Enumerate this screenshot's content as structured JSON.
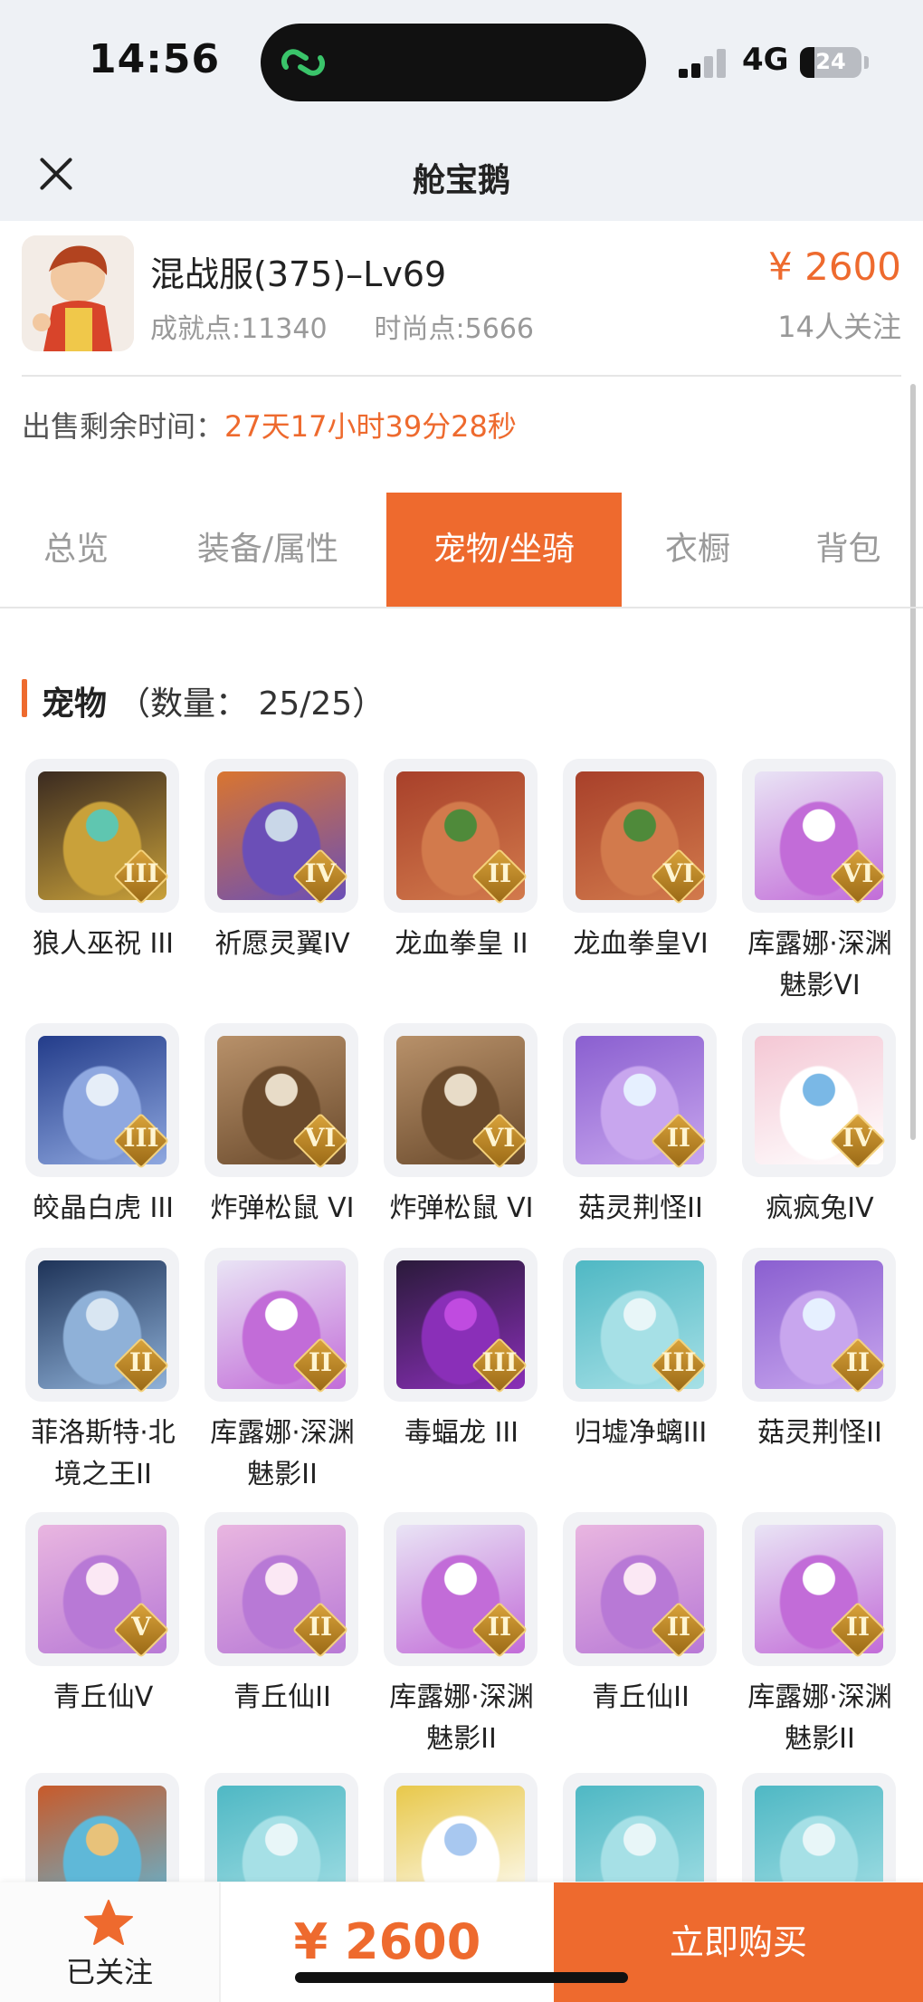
{
  "status_bar": {
    "time": "14:56",
    "network": "4G",
    "battery": "24",
    "battery_level": 0.24
  },
  "nav": {
    "title": "舱宝鹅"
  },
  "product": {
    "name": "混战服(375)–Lv69",
    "achievement": "成就点:11340",
    "fashion": "时尚点:5666",
    "price": "¥ 2600",
    "followers": "14人关注"
  },
  "sale": {
    "label": "出售剩余时间：",
    "value": "27天17小时39分28秒"
  },
  "tabs": [
    {
      "label": "总览",
      "active": false
    },
    {
      "label": "装备/属性",
      "active": false
    },
    {
      "label": "宠物/坐骑",
      "active": true
    },
    {
      "label": "衣橱",
      "active": false
    },
    {
      "label": "背包",
      "active": false
    }
  ],
  "section": {
    "title": "宠物",
    "count": "（数量：  25/25）"
  },
  "pets": [
    {
      "name": "狼人巫祝 III",
      "rank": "III",
      "icon": "werewolf-shaman-icon",
      "colors": [
        "#3a2a20",
        "#c9a13a",
        "#5fc6b0"
      ]
    },
    {
      "name": "祈愿灵翼IV",
      "rank": "IV",
      "icon": "wish-wing-eagle-icon",
      "colors": [
        "#d9752f",
        "#6b4fb7",
        "#c9d7e8"
      ]
    },
    {
      "name": "龙血拳皇 II",
      "rank": "II",
      "icon": "dragonblood-boxer-icon",
      "colors": [
        "#a8402a",
        "#d27a4c",
        "#4f8a3a"
      ]
    },
    {
      "name": "龙血拳皇VI",
      "rank": "VI",
      "icon": "dragonblood-boxer-icon",
      "colors": [
        "#a8402a",
        "#d27a4c",
        "#4f8a3a"
      ]
    },
    {
      "name": "库露娜·深渊魅影VI",
      "rank": "VI",
      "icon": "kuluna-abyss-icon",
      "colors": [
        "#e9e4f5",
        "#c26cd8",
        "#ffffff"
      ]
    },
    {
      "name": "皎晶白虎 III",
      "rank": "III",
      "icon": "crystal-white-tiger-icon",
      "colors": [
        "#233c8a",
        "#8fa8e0",
        "#e6eef8"
      ]
    },
    {
      "name": "炸弹松鼠 VI",
      "rank": "VI",
      "icon": "bomb-squirrel-icon",
      "colors": [
        "#b8916a",
        "#6a4a2c",
        "#e8dcc8"
      ]
    },
    {
      "name": "炸弹松鼠 VI",
      "rank": "VI",
      "icon": "bomb-squirrel-icon",
      "colors": [
        "#b8916a",
        "#6a4a2c",
        "#e8dcc8"
      ]
    },
    {
      "name": "菇灵荆怪II",
      "rank": "II",
      "icon": "mushroom-spirit-icon",
      "colors": [
        "#8a5fd0",
        "#c8a6ee",
        "#e6f0ff"
      ]
    },
    {
      "name": "疯疯兔IV",
      "rank": "IV",
      "icon": "crazy-rabbit-icon",
      "colors": [
        "#f4c7d4",
        "#ffffff",
        "#7ab8e6"
      ]
    },
    {
      "name": "菲洛斯特·北境之王II",
      "rank": "II",
      "icon": "frost-king-icon",
      "colors": [
        "#1e3358",
        "#8fb1d8",
        "#d9e6f2"
      ]
    },
    {
      "name": "库露娜·深渊魅影II",
      "rank": "II",
      "icon": "kuluna-abyss-icon",
      "colors": [
        "#e9e4f5",
        "#c26cd8",
        "#ffffff"
      ]
    },
    {
      "name": "毒蝠龙 III",
      "rank": "III",
      "icon": "venom-bat-dragon-icon",
      "colors": [
        "#2a1a3a",
        "#8a2fb8",
        "#c04be0"
      ]
    },
    {
      "name": "归墟净螭III",
      "rank": "III",
      "icon": "void-pure-dragon-icon",
      "colors": [
        "#4fb8c4",
        "#a6e0e6",
        "#e8f6f8"
      ]
    },
    {
      "name": "菇灵荆怪II",
      "rank": "II",
      "icon": "mushroom-spirit-icon",
      "colors": [
        "#8a5fd0",
        "#c8a6ee",
        "#e6f0ff"
      ]
    },
    {
      "name": "青丘仙V",
      "rank": "V",
      "icon": "qingqiu-fairy-icon",
      "colors": [
        "#e9b6e0",
        "#b879d6",
        "#fbe8f4"
      ]
    },
    {
      "name": "青丘仙II",
      "rank": "II",
      "icon": "qingqiu-fairy-icon",
      "colors": [
        "#e9b6e0",
        "#b879d6",
        "#fbe8f4"
      ]
    },
    {
      "name": "库露娜·深渊魅影II",
      "rank": "II",
      "icon": "kuluna-abyss-icon",
      "colors": [
        "#e9e4f5",
        "#c26cd8",
        "#ffffff"
      ]
    },
    {
      "name": "青丘仙II",
      "rank": "II",
      "icon": "qingqiu-fairy-icon",
      "colors": [
        "#e9b6e0",
        "#b879d6",
        "#fbe8f4"
      ]
    },
    {
      "name": "库露娜·深渊魅影II",
      "rank": "II",
      "icon": "kuluna-abyss-icon",
      "colors": [
        "#e9e4f5",
        "#c26cd8",
        "#ffffff"
      ]
    },
    {
      "name": "",
      "rank": "",
      "icon": "fire-beast-icon",
      "colors": [
        "#c85a2a",
        "#5fb8d8",
        "#e8c27a"
      ]
    },
    {
      "name": "",
      "rank": "",
      "icon": "void-pure-dragon-icon",
      "colors": [
        "#4fb8c4",
        "#a6e0e6",
        "#e8f6f8"
      ]
    },
    {
      "name": "",
      "rank": "",
      "icon": "golden-crown-fairy-icon",
      "colors": [
        "#e8c84a",
        "#ffffff",
        "#a8c8f0"
      ]
    },
    {
      "name": "",
      "rank": "",
      "icon": "void-pure-dragon-icon",
      "colors": [
        "#4fb8c4",
        "#a6e0e6",
        "#e8f6f8"
      ]
    },
    {
      "name": "",
      "rank": "",
      "icon": "void-pure-dragon-icon",
      "colors": [
        "#4fb8c4",
        "#a6e0e6",
        "#e8f6f8"
      ]
    }
  ],
  "bottom_bar": {
    "follow_label": "已关注",
    "price": "¥ 2600",
    "buy_label": "立即购买"
  },
  "colors": {
    "accent": "#ee6a2e"
  }
}
